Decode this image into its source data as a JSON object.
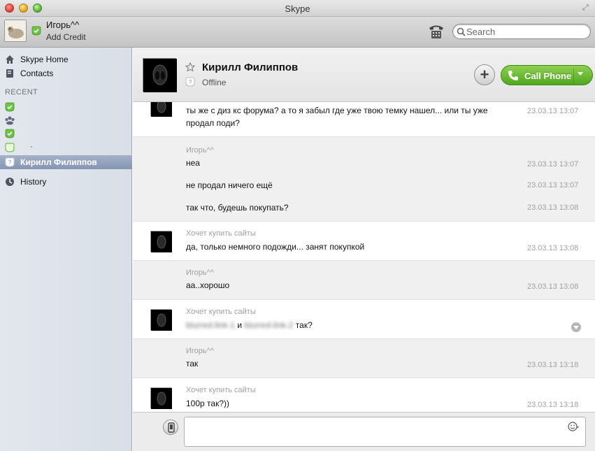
{
  "window": {
    "title": "Skype"
  },
  "profile": {
    "name": "Игорь^^",
    "credit_link": "Add Credit"
  },
  "search": {
    "placeholder": "Search"
  },
  "sidebar": {
    "nav": [
      {
        "label": "Skype Home",
        "icon": "home-icon"
      },
      {
        "label": "Contacts",
        "icon": "contacts-icon"
      }
    ],
    "recent_heading": "RECENT",
    "recent": [
      {
        "label": "",
        "status": "online"
      },
      {
        "label": "",
        "status": "group"
      },
      {
        "label": "",
        "status": "online"
      },
      {
        "label": "",
        "status": "away"
      },
      {
        "label": "Кирилл Филиппов",
        "status": "offline",
        "selected": true
      }
    ],
    "history": {
      "label": "History",
      "icon": "clock-icon"
    }
  },
  "contact": {
    "name": "Кирилл Филиппов",
    "status": "Offline",
    "call_label": "Call Phone"
  },
  "messages": [
    {
      "side": "incoming",
      "sender": "",
      "lines": [
        {
          "text": "ты же с диз кс форума? а то я забыл где уже твою темку нашел... или ты уже продал поди?",
          "time": "23.03.13 13:07"
        }
      ]
    },
    {
      "side": "outgoing",
      "sender": "Игорь^^",
      "lines": [
        {
          "text": "неа",
          "time": "23.03.13 13:07"
        },
        {
          "text": "не продал ничего ещё",
          "time": "23.03.13 13:07"
        },
        {
          "text": "так что, будешь покупать?",
          "time": "23.03.13 13:08"
        }
      ]
    },
    {
      "side": "incoming",
      "sender": "Хочет купить сайты",
      "lines": [
        {
          "text": "да, только немного подожди... занят покупкой",
          "time": "23.03.13 13:08"
        }
      ]
    },
    {
      "side": "outgoing",
      "sender": "Игорь^^",
      "lines": [
        {
          "text": "аа..хорошо",
          "time": "23.03.13 13:08"
        }
      ]
    },
    {
      "side": "incoming",
      "sender": "Хочет купить сайты",
      "lines": [
        {
          "text_before": "",
          "text_blur1": "blurred-link-1",
          "text_mid": "и",
          "text_blur2": "blurred-link-2",
          "text_after": "так?",
          "time": ""
        }
      ]
    },
    {
      "side": "outgoing",
      "sender": "Игорь^^",
      "lines": [
        {
          "text": "так",
          "time": "23.03.13 13:18"
        }
      ]
    },
    {
      "side": "incoming",
      "sender": "Хочет купить сайты",
      "lines": [
        {
          "text": "100р так?))",
          "time": "23.03.13 13:18"
        }
      ]
    }
  ],
  "colors": {
    "call_green": "#5cb82a",
    "selected_row": "#8e9fbb",
    "sidebar_bg": "#dde3ea"
  }
}
